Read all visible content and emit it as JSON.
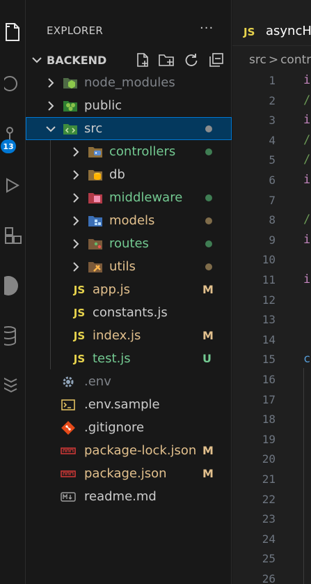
{
  "activity_bar": {
    "icons": [
      "explorer-icon",
      "search-icon",
      "source-control-icon",
      "run-debug-icon",
      "extensions-icon",
      "account-icon",
      "database-icon",
      "layers-icon"
    ],
    "badge": "13",
    "accent": "#0078d4"
  },
  "sidebar": {
    "title": "EXPLORER",
    "more": "···",
    "section_title": "BACKEND",
    "section_actions": [
      "new-file-icon",
      "new-folder-icon",
      "refresh-icon",
      "collapse-all-icon"
    ],
    "items": [
      {
        "name": "node_modules",
        "icon": "node-folder-icon",
        "kind": "folder",
        "expanded": false,
        "color": "#7f8389",
        "status": ""
      },
      {
        "name": "public",
        "icon": "public-folder-icon",
        "kind": "folder",
        "expanded": false,
        "color": "#cccccc",
        "status": ""
      },
      {
        "name": "src",
        "icon": "src-folder-icon",
        "kind": "folder",
        "expanded": true,
        "color": "#cccccc",
        "status": "dot",
        "status_color": "#8c8c8c",
        "selected": true
      },
      {
        "name": "controllers",
        "icon": "controllers-folder-icon",
        "kind": "folder",
        "expanded": false,
        "color": "#73c991",
        "status": "dot",
        "status_color": "#3f7d53"
      },
      {
        "name": "db",
        "icon": "db-folder-icon",
        "kind": "folder",
        "expanded": false,
        "color": "#cccccc",
        "status": ""
      },
      {
        "name": "middleware",
        "icon": "middleware-folder-icon",
        "kind": "folder",
        "expanded": false,
        "color": "#73c991",
        "status": "dot",
        "status_color": "#3f7d53"
      },
      {
        "name": "models",
        "icon": "models-folder-icon",
        "kind": "folder",
        "expanded": false,
        "color": "#e2c08d",
        "status": "dot",
        "status_color": "#7f6c4a"
      },
      {
        "name": "routes",
        "icon": "routes-folder-icon",
        "kind": "folder",
        "expanded": false,
        "color": "#73c991",
        "status": "dot",
        "status_color": "#3f7d53"
      },
      {
        "name": "utils",
        "icon": "utils-folder-icon",
        "kind": "folder",
        "expanded": false,
        "color": "#e2c08d",
        "status": "dot",
        "status_color": "#7f6c4a"
      },
      {
        "name": "app.js",
        "icon": "js-file-icon",
        "kind": "file",
        "color": "#e2c08d",
        "status": "M",
        "status_color": "#e2c08d"
      },
      {
        "name": "constants.js",
        "icon": "js-file-icon",
        "kind": "file",
        "color": "#cccccc",
        "status": ""
      },
      {
        "name": "index.js",
        "icon": "js-file-icon",
        "kind": "file",
        "color": "#e2c08d",
        "status": "M",
        "status_color": "#e2c08d"
      },
      {
        "name": "test.js",
        "icon": "js-file-icon",
        "kind": "file",
        "color": "#73c991",
        "status": "U",
        "status_color": "#73c991"
      },
      {
        "name": ".env",
        "icon": "gear-icon",
        "kind": "file",
        "color": "#7f8389",
        "status": ""
      },
      {
        "name": ".env.sample",
        "icon": "terminal-icon",
        "kind": "file",
        "color": "#cccccc",
        "status": ""
      },
      {
        "name": ".gitignore",
        "icon": "git-icon",
        "kind": "file",
        "color": "#cccccc",
        "status": ""
      },
      {
        "name": "package-lock.json",
        "icon": "npm-icon",
        "kind": "file",
        "color": "#e2c08d",
        "status": "M",
        "status_color": "#e2c08d"
      },
      {
        "name": "package.json",
        "icon": "npm-icon",
        "kind": "file",
        "color": "#e2c08d",
        "status": "M",
        "status_color": "#e2c08d"
      },
      {
        "name": "readme.md",
        "icon": "markdown-icon",
        "kind": "file",
        "color": "#cccccc",
        "status": ""
      }
    ],
    "js_label": "JS"
  },
  "editor": {
    "tab": {
      "icon_label": "JS",
      "name": "asyncHa"
    },
    "breadcrumb": {
      "root": "src",
      "sep": ">",
      "next": "contr"
    },
    "line_numbers": [
      "1",
      "2",
      "3",
      "4",
      "5",
      "6",
      "7",
      "8",
      "9",
      "10",
      "11",
      "12",
      "13",
      "14",
      "15",
      "16",
      "17",
      "18",
      "19",
      "20",
      "21",
      "22",
      "23",
      "24",
      "25",
      "26"
    ],
    "code_lines": [
      {
        "text": "i",
        "color": "#c586c0"
      },
      {
        "text": "/",
        "color": "#6a9955"
      },
      {
        "text": "i",
        "color": "#c586c0"
      },
      {
        "text": "/",
        "color": "#6a9955"
      },
      {
        "text": "/",
        "color": "#6a9955"
      },
      {
        "text": "i",
        "color": "#c586c0"
      },
      {
        "text": "",
        "color": "#cccccc"
      },
      {
        "text": "/",
        "color": "#6a9955"
      },
      {
        "text": "i",
        "color": "#c586c0"
      },
      {
        "text": "",
        "color": "#cccccc"
      },
      {
        "text": "i",
        "color": "#c586c0"
      },
      {
        "text": "",
        "color": "#cccccc"
      },
      {
        "text": "",
        "color": "#cccccc"
      },
      {
        "text": "",
        "color": "#cccccc"
      },
      {
        "text": "c",
        "color": "#569cd6"
      }
    ]
  }
}
